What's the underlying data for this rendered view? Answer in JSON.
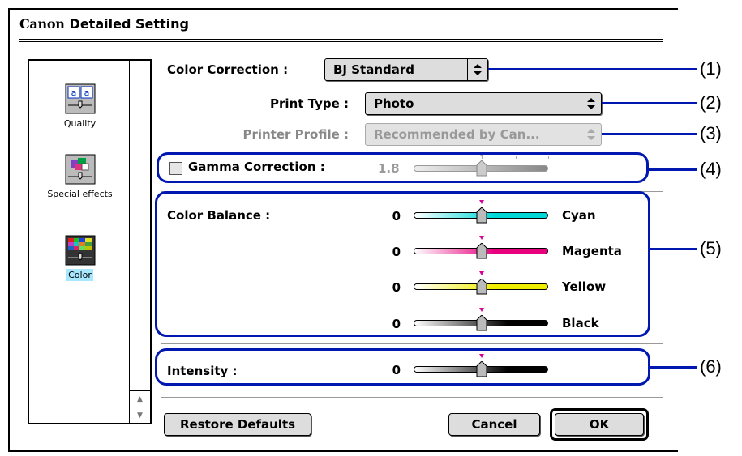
{
  "dialog": {
    "brand": "Canon",
    "title": "Detailed Setting"
  },
  "sidebar": {
    "items": [
      {
        "label": "Quality",
        "icon": "quality-icon",
        "selected": false
      },
      {
        "label": "Special effects",
        "icon": "special-effects-icon",
        "selected": false
      },
      {
        "label": "Color",
        "icon": "color-icon",
        "selected": true
      }
    ]
  },
  "color_correction": {
    "label": "Color Correction :",
    "value": "BJ Standard"
  },
  "print_type": {
    "label": "Print Type :",
    "value": "Photo"
  },
  "printer_profile": {
    "label": "Printer Profile :",
    "value": "Recommended by Can...",
    "disabled": true
  },
  "gamma": {
    "label": "Gamma Correction :",
    "value": "1.8",
    "checked": false,
    "disabled": true
  },
  "color_balance": {
    "label": "Color Balance :",
    "channels": [
      {
        "value": "0",
        "name": "Cyan",
        "color": "#00d8d8"
      },
      {
        "value": "0",
        "name": "Magenta",
        "color": "#e8007e"
      },
      {
        "value": "0",
        "name": "Yellow",
        "color": "#f0ee00"
      },
      {
        "value": "0",
        "name": "Black",
        "color": "#000000"
      }
    ]
  },
  "intensity": {
    "label": "Intensity :",
    "value": "0"
  },
  "buttons": {
    "restore": "Restore Defaults",
    "cancel": "Cancel",
    "ok": "OK"
  },
  "callouts": [
    "(1)",
    "(2)",
    "(3)",
    "(4)",
    "(5)",
    "(6)"
  ],
  "colors": {
    "callout": "#0017b0",
    "selected_highlight": "#a8e8ff",
    "marker": "#d60094"
  }
}
